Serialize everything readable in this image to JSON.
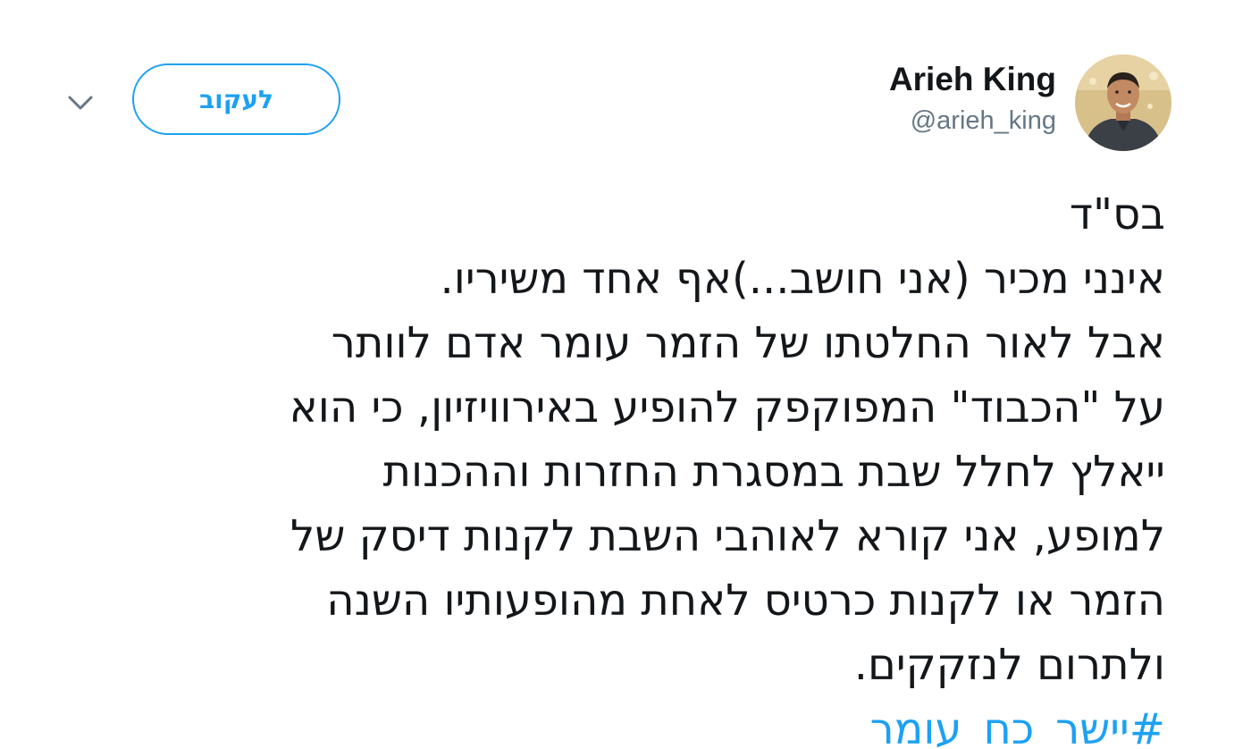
{
  "author": {
    "name": "Arieh King",
    "handle": "@arieh_king"
  },
  "follow_label": "לעקוב",
  "icons": {
    "menu": "chevron-down-icon",
    "avatar": "profile-photo"
  },
  "colors": {
    "accent": "#1da1f2",
    "text": "#14171a",
    "secondary": "#657786"
  },
  "tweet": {
    "lines": [
      "בס\"ד",
      "אינני מכיר (אני חושב...)אף אחד משיריו.",
      "אבל לאור החלטתו של הזמר עומר אדם לוותר",
      "על \"הכבוד\" המפוקפק להופיע באירוויזיון, כי הוא",
      "ייאלץ לחלל שבת במסגרת החזרות וההכנות",
      "למופע, אני קורא לאוהבי השבת לקנות דיסק של",
      "הזמר או לקנות כרטיס לאחת מהופעותיו השנה",
      "ולתרום לנזקקים."
    ],
    "hashtag": "#יישר_כח_עומר"
  }
}
